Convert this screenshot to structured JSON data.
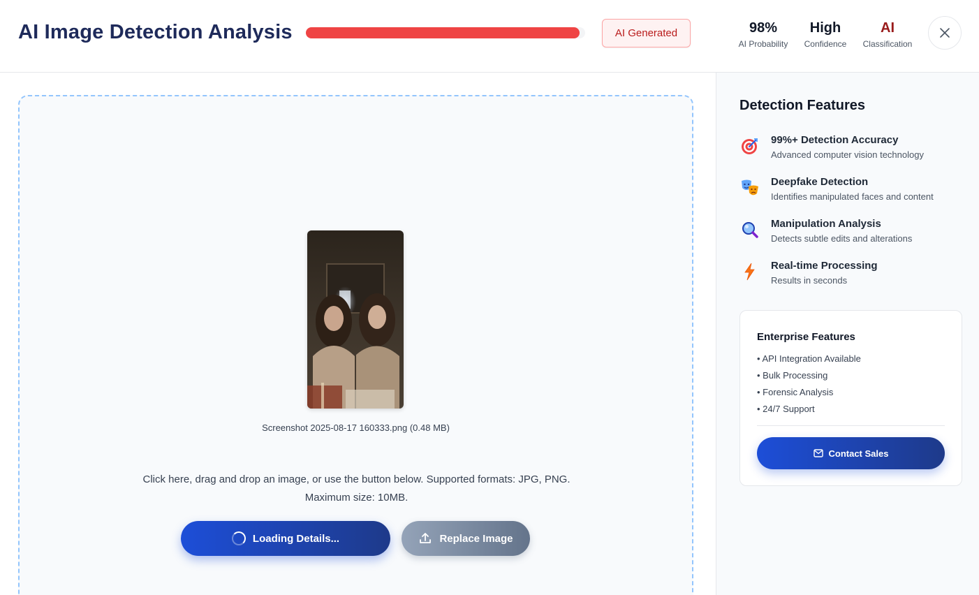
{
  "header": {
    "title": "AI Image Detection Analysis",
    "progress_fraction": 0.98,
    "badge": "AI Generated",
    "stats": [
      {
        "value": "98%",
        "label": "AI Probability"
      },
      {
        "value": "High",
        "label": "Confidence"
      },
      {
        "value": "AI",
        "label": "Classification"
      }
    ],
    "close_icon": "close-icon"
  },
  "upload": {
    "filename": "Screenshot 2025-08-17 160333.png (0.48 MB)",
    "instructions_line1": "Click here, drag and drop an image, or use the button below. Supported formats: JPG, PNG.",
    "instructions_line2": "Maximum size: 10MB.",
    "primary_button": "Loading Details...",
    "secondary_button": "Replace Image"
  },
  "sidebar": {
    "title": "Detection Features",
    "features": [
      {
        "icon": "target-icon",
        "name": "99%+ Detection Accuracy",
        "desc": "Advanced computer vision technology"
      },
      {
        "icon": "theater-masks-icon",
        "name": "Deepfake Detection",
        "desc": "Identifies manipulated faces and content"
      },
      {
        "icon": "magnifier-icon",
        "name": "Manipulation Analysis",
        "desc": "Detects subtle edits and alterations"
      },
      {
        "icon": "lightning-icon",
        "name": "Real-time Processing",
        "desc": "Results in seconds"
      }
    ],
    "enterprise": {
      "title": "Enterprise Features",
      "items": [
        "• API Integration Available",
        "• Bulk Processing",
        "• Forensic Analysis",
        "• 24/7 Support"
      ],
      "button": "Contact Sales"
    }
  },
  "colors": {
    "accent": "#1d4ed8",
    "danger": "#ef4444",
    "title": "#1e2a5a"
  }
}
